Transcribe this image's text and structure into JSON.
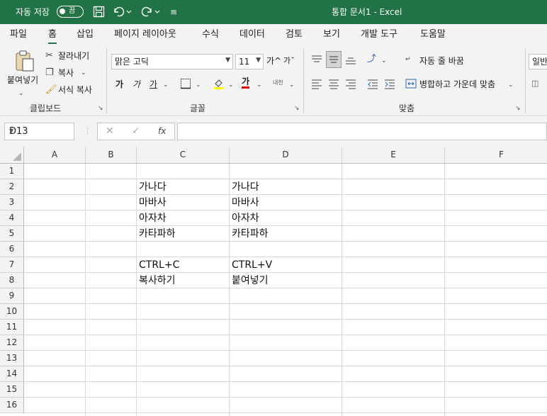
{
  "titlebar": {
    "autosave_label": "자동 저장",
    "autosave_state": "끔",
    "document_title": "통합 문서1  -  Excel",
    "bg_color": "#217346"
  },
  "tabs": [
    "파일",
    "홈",
    "삽입",
    "페이지 레이아웃",
    "수식",
    "데이터",
    "검토",
    "보기",
    "개발 도구",
    "도움말"
  ],
  "active_tab": "홈",
  "ribbon": {
    "clipboard": {
      "paste": "붙여넣기",
      "cut": "잘라내기",
      "copy": "복사",
      "format_painter": "서식 복사",
      "group_name": "클립보드"
    },
    "font": {
      "font_name": "맑은 고딕",
      "font_size": "11",
      "grow_label": "가^",
      "shrink_label": "가ˇ",
      "bold": "가",
      "italic": "가",
      "underline": "가",
      "font_color_label": "가",
      "phonetic": "내천",
      "group_name": "글꼴"
    },
    "alignment": {
      "wrap_text": "자동 줄 바꿈",
      "merge_center": "병합하고 가운데 맞춤",
      "group_name": "맞춤"
    },
    "number": {
      "format": "일반"
    }
  },
  "formula_bar": {
    "name_box": "D13",
    "fx_label": "fx",
    "formula": ""
  },
  "sheet": {
    "columns": [
      "A",
      "B",
      "C",
      "D",
      "E",
      "F"
    ],
    "rows": [
      "1",
      "2",
      "3",
      "4",
      "5",
      "6",
      "7",
      "8",
      "9",
      "10",
      "11",
      "12",
      "13",
      "14",
      "15",
      "16"
    ],
    "cells": {
      "C2": "가나다",
      "D2": "가나다",
      "C3": "마바사",
      "D3": "마바사",
      "C4": "아자차",
      "D4": "아자차",
      "C5": "카타파하",
      "D5": "카타파하",
      "C7": "CTRL+C",
      "D7": "CTRL+V",
      "C8": "복사하기",
      "D8": "붙여넣기"
    }
  }
}
